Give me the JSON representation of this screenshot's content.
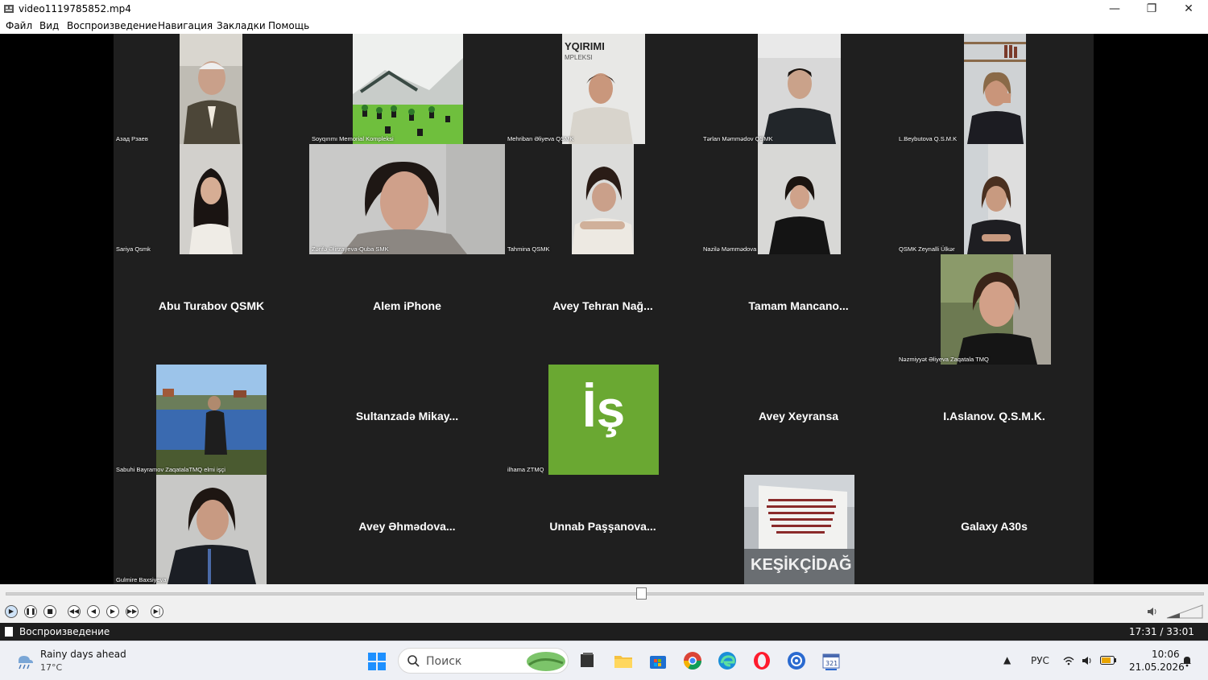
{
  "window": {
    "title": "video1119785852.mp4",
    "controls": {
      "minimize": "—",
      "maximize": "❐",
      "close": "✕"
    }
  },
  "menu": [
    "Файл",
    "Вид",
    "Воспроизведение",
    "Навигация",
    "Закладки",
    "Помощь"
  ],
  "participants": {
    "row1": [
      {
        "name": "Азад Рзаев",
        "video": "elderly-man-suit"
      },
      {
        "name": "Soyqırımı Memorial Kompleksi",
        "video": "memorial-park"
      },
      {
        "name": "Mehriban Əliyeva QSMK",
        "video": "woman-office",
        "overlay_text": "YQIRIMI",
        "overlay_text2": "MPLEKSI"
      },
      {
        "name": "Tərlan Məmmədov QSMK",
        "video": "young-man"
      },
      {
        "name": "L.Beybutova Q.S.M.K",
        "video": "woman-bookshelf"
      }
    ],
    "row2": [
      {
        "name": "Sariya Qsmk",
        "video": "young-woman-dark-hair"
      },
      {
        "name": "Zərifə Əlirzayeva-Quba SMK",
        "video": "woman-closeup"
      },
      {
        "name": "Tahmina QSMK",
        "video": "woman-leaning"
      },
      {
        "name": "Nazilə Məmmədova",
        "video": "woman-dark-room"
      },
      {
        "name": "QSMK Zeynalli Ülkər",
        "video": "woman-hands-clasped"
      }
    ],
    "row3": [
      {
        "name": "Abu Turabov QSMK"
      },
      {
        "name": "Alem iPhone"
      },
      {
        "name": "Avey  Tehran  Nağ..."
      },
      {
        "name": "Tamam  Mancano..."
      },
      {
        "name": "Nəzmiyyət Əliyeva Zaqatala TMQ",
        "video": "woman-outdoor-smiling"
      }
    ],
    "row4": [
      {
        "name": "Sabuhi Bayramov ZaqatalaTMQ elmi işçi",
        "video": "man-by-lake"
      },
      {
        "name": "Sultanzadə  Mikay..."
      },
      {
        "name": "ilhama ZTMQ",
        "video": "green-logo",
        "logo_text": "İş"
      },
      {
        "name": "Avey  Xeyransa"
      },
      {
        "name": "I.Aslanov.  Q.S.M.K."
      }
    ],
    "row5": [
      {
        "name": "Gulmire Baxsiyeva",
        "video": "woman-portrait"
      },
      {
        "name": "Avey  Əhmədova..."
      },
      {
        "name": "Unnab  Paşşanova..."
      },
      {
        "name": "",
        "video": "monument-keşikçidağ",
        "sign_text": "KEŞİKÇİDAĞ"
      },
      {
        "name": "Galaxy A30s"
      }
    ]
  },
  "player": {
    "seek_progress": 0.5306,
    "volume_icon": "speaker-icon",
    "status": "Воспроизведение",
    "time": "17:31 / 33:01"
  },
  "taskbar": {
    "weather_title": "Rainy days ahead",
    "weather_temp": "17°C",
    "search_placeholder": "Поиск",
    "lang": "РУС",
    "time": "10:06",
    "date": "21.05.2026"
  },
  "colors": {
    "grid_bg": "#1f1f1f",
    "logo_green": "#6aa832"
  }
}
